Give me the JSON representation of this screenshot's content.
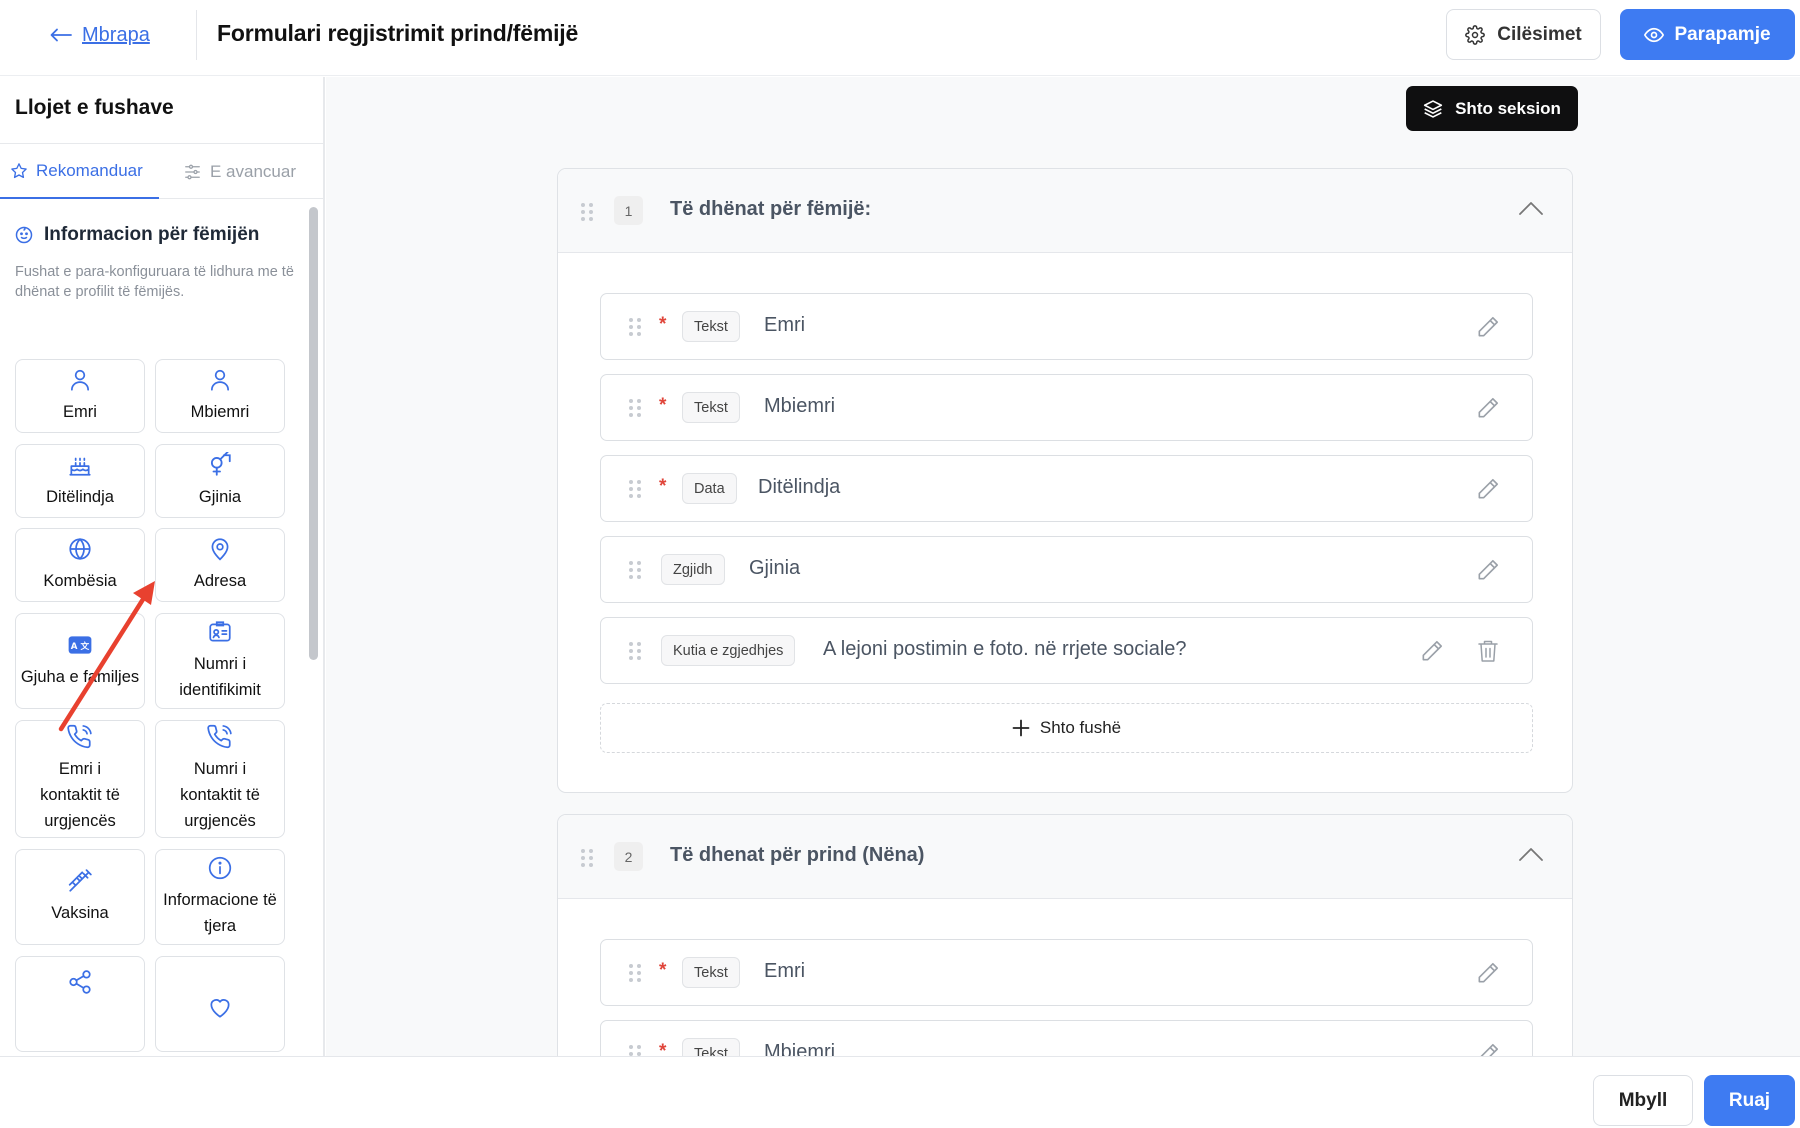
{
  "header": {
    "back_label": "Mbrapa",
    "title": "Formulari regjistrimit prind/fëmijë",
    "settings_label": "Cilësimet",
    "preview_label": "Parapamje"
  },
  "sidebar": {
    "title": "Llojet e fushave",
    "tabs": [
      {
        "label": "Rekomanduar",
        "icon": "star-icon",
        "active": true
      },
      {
        "label": "E avancuar",
        "icon": "sliders-icon",
        "active": false
      }
    ],
    "section_title": "Informacion për fëmijën",
    "section_description": "Fushat e para-konfiguruara të lidhura me të dhënat e profilit të fëmijës.",
    "tiles": [
      {
        "label": "Emri",
        "icon": "user-icon"
      },
      {
        "label": "Mbiemri",
        "icon": "user-icon"
      },
      {
        "label": "Ditëlindja",
        "icon": "cake-icon"
      },
      {
        "label": "Gjinia",
        "icon": "gender-icon"
      },
      {
        "label": "Kombësia",
        "icon": "globe-icon"
      },
      {
        "label": "Adresa",
        "icon": "map-pin-icon"
      },
      {
        "label": "Gjuha e familjes",
        "icon": "language-icon"
      },
      {
        "label": "Numri i identifikimit",
        "icon": "id-card-icon"
      },
      {
        "label": "Emri i kontaktit të urgjencës",
        "icon": "phone-call-icon"
      },
      {
        "label": "Numri i kontaktit të urgjencës",
        "icon": "phone-call-icon"
      },
      {
        "label": "Vaksina",
        "icon": "syringe-icon"
      },
      {
        "label": "Informacione të tjera",
        "icon": "info-icon"
      },
      {
        "label": "",
        "icon": "share-icon"
      },
      {
        "label": "",
        "icon": "heart-icon"
      }
    ]
  },
  "main": {
    "add_section_label": "Shto seksion",
    "sections": [
      {
        "number": "1",
        "title": "Të dhënat për fëmijë:",
        "fields": [
          {
            "required": true,
            "type": "Tekst",
            "label": "Emri"
          },
          {
            "required": true,
            "type": "Tekst",
            "label": "Mbiemri"
          },
          {
            "required": true,
            "type": "Data",
            "label": "Ditëlindja"
          },
          {
            "required": false,
            "type": "Zgjidh",
            "label": "Gjinia"
          },
          {
            "required": false,
            "type": "Kutia e zgjedhjes",
            "label": "A lejoni postimin e foto. në rrjete sociale?"
          }
        ],
        "add_field_label": "Shto fushë"
      },
      {
        "number": "2",
        "title": "Të dhenat për prind (Nëna)",
        "fields": [
          {
            "required": true,
            "type": "Tekst",
            "label": "Emri"
          },
          {
            "required": true,
            "type": "Tekst",
            "label": "Mbiemri"
          }
        ]
      }
    ]
  },
  "footer": {
    "close_label": "Mbyll",
    "save_label": "Ruaj"
  },
  "colors": {
    "accent": "#3e7bf2",
    "link": "#3b6fe5",
    "required": "#e0453a",
    "annotation_arrow": "#e8412f"
  }
}
